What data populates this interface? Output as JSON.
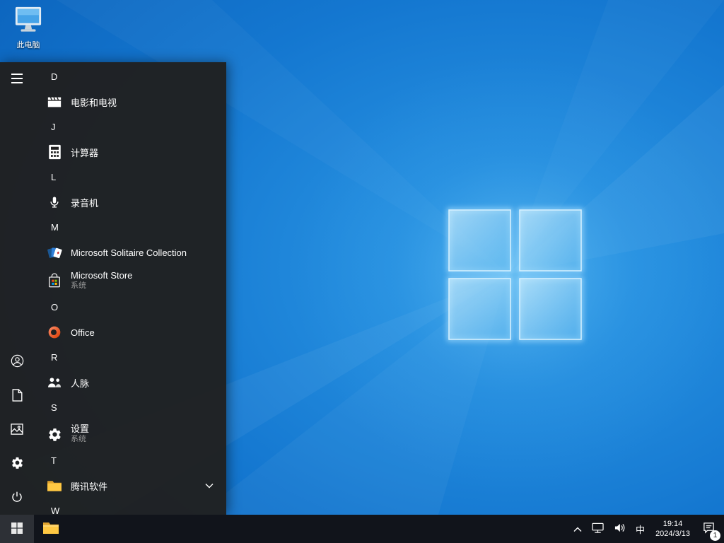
{
  "desktop": {
    "this_pc_label": "此电脑"
  },
  "start_menu": {
    "rail_icons": [
      "hamburger-menu",
      "account",
      "documents",
      "pictures",
      "settings",
      "power"
    ],
    "sections": [
      {
        "letter": "D",
        "apps": [
          {
            "label": "电影和电视",
            "icon": "movies-tv"
          }
        ]
      },
      {
        "letter": "J",
        "apps": [
          {
            "label": "计算器",
            "icon": "calculator"
          }
        ]
      },
      {
        "letter": "L",
        "apps": [
          {
            "label": "录音机",
            "icon": "voice-recorder"
          }
        ]
      },
      {
        "letter": "M",
        "apps": [
          {
            "label": "Microsoft Solitaire Collection",
            "icon": "solitaire-cards"
          },
          {
            "label": "Microsoft Store",
            "sublabel": "系统",
            "icon": "microsoft-store"
          }
        ]
      },
      {
        "letter": "O",
        "apps": [
          {
            "label": "Office",
            "icon": "office"
          }
        ]
      },
      {
        "letter": "R",
        "apps": [
          {
            "label": "人脉",
            "icon": "people"
          }
        ]
      },
      {
        "letter": "S",
        "apps": [
          {
            "label": "设置",
            "sublabel": "系统",
            "icon": "settings-gear"
          }
        ]
      },
      {
        "letter": "T",
        "apps": [
          {
            "label": "腾讯软件",
            "icon": "folder",
            "expandable": true
          }
        ]
      },
      {
        "letter": "W",
        "apps": []
      }
    ]
  },
  "taskbar": {
    "tray": {
      "ime": "中",
      "time": "19:14",
      "date": "2024/3/13",
      "notification_count": "1"
    }
  },
  "colors": {
    "wallpaper_blue": "#1477d0",
    "menu_bg": "#202020",
    "taskbar_bg": "#11141b",
    "folder_yellow": "#ffc843",
    "office_orange": "#d83b01",
    "ms_red": "#f25022",
    "ms_green": "#7fba00",
    "ms_blue": "#00a4ef",
    "ms_yellow": "#ffb900"
  }
}
